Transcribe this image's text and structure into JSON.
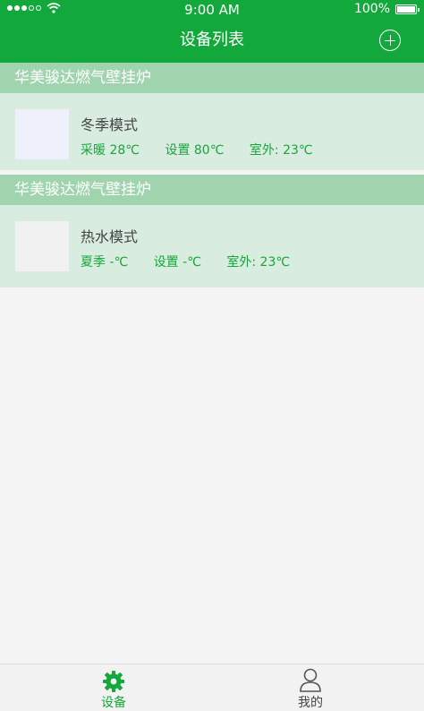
{
  "status_bar": {
    "time": "9:00 AM",
    "battery": "100%"
  },
  "header": {
    "title": "设备列表",
    "add_icon": "plus-circle-icon"
  },
  "devices": [
    {
      "name": "华美骏达燃气壁挂炉",
      "mode": "冬季模式",
      "meta1": "采暖 28℃",
      "meta2": "设置 80℃",
      "meta3": "室外: 23℃"
    },
    {
      "name": "华美骏达燃气壁挂炉",
      "mode": "热水模式",
      "meta1": "夏季 -℃",
      "meta2": "设置 -℃",
      "meta3": "室外: 23℃"
    }
  ],
  "tabbar": {
    "devices_label": "设备",
    "me_label": "我的"
  },
  "colors": {
    "primary": "#13a83b",
    "section": "#9fd4ae",
    "card": "#d8ecdf"
  }
}
